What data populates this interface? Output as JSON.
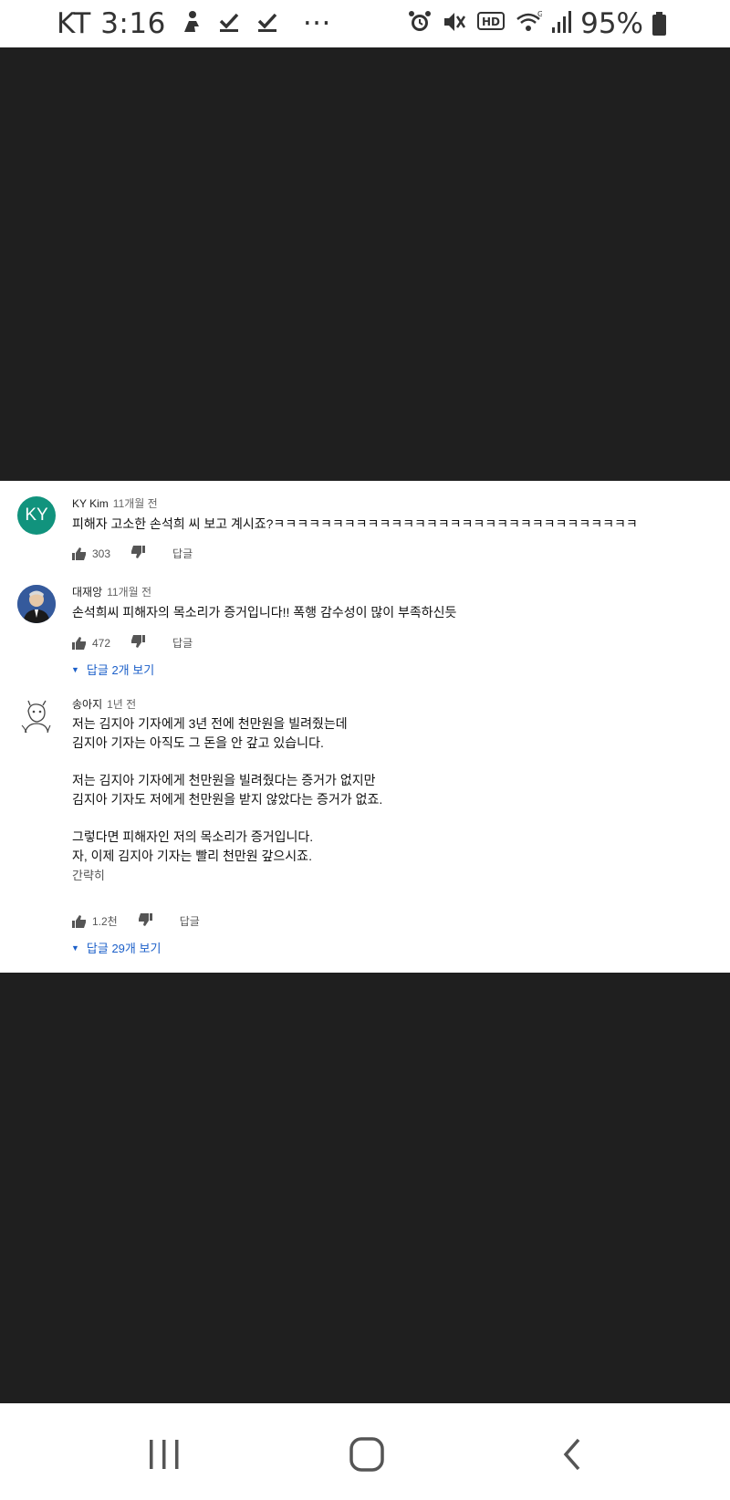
{
  "status_bar": {
    "carrier_time": "KT 3:16",
    "more": "···",
    "battery_percent": "95%",
    "hd_label": "HD",
    "network_label": "G",
    "icons": [
      "personal-hotspot-icon",
      "download-done-icon",
      "download-done-icon",
      "alarm-icon",
      "mute-icon",
      "hd-voice-icon",
      "wifi-icon",
      "signal-icon",
      "battery-icon"
    ]
  },
  "comments": [
    {
      "author": "KY Kim",
      "time": "11개월 전",
      "avatar_initials": "KY",
      "avatar_color": "#11937d",
      "lines": [
        "피해자 고소한 손석희 씨 보고 계시죠?ㅋㅋㅋㅋㅋㅋㅋㅋㅋㅋㅋㅋㅋㅋㅋㅋㅋㅋㅋㅋㅋㅋㅋㅋㅋㅋㅋㅋㅋㅋㅋ"
      ],
      "likes": "303",
      "reply_label": "답글"
    },
    {
      "author": "대재앙",
      "time": "11개월 전",
      "lines": [
        "손석희씨 피해자의 목소리가 증거입니다!! 폭행 감수성이 많이 부족하신듯"
      ],
      "likes": "472",
      "reply_label": "답글",
      "replies_toggle": "답글 2개 보기"
    },
    {
      "author": "송아지",
      "time": "1년 전",
      "paragraphs": [
        [
          "저는 김지아 기자에게 3년 전에 천만원을 빌려줬는데",
          "김지아 기자는 아직도 그 돈을 안 갚고 있습니다."
        ],
        [
          "저는 김지아 기자에게 천만원을 빌려줬다는 증거가 없지만",
          "김지아 기자도 저에게 천만원을 받지 않았다는 증거가 없죠."
        ],
        [
          "그렇다면 피해자인 저의 목소리가 증거입니다.",
          "자, 이제 김지아 기자는 빨리 천만원 갚으시죠."
        ]
      ],
      "collapse_label": "간략히",
      "likes": "1.2천",
      "reply_label": "답글",
      "replies_toggle": "답글 29개 보기"
    }
  ],
  "nav_bar": {
    "buttons": [
      "recent-apps-icon",
      "home-icon",
      "back-icon"
    ]
  }
}
